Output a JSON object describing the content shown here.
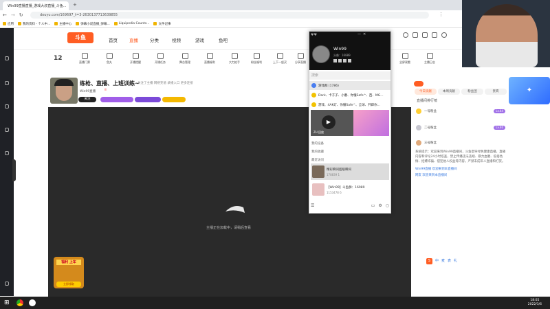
{
  "browser": {
    "tabs": [
      {
        "label": "Win99直播直播_游戏大叔直播_斗鱼..."
      },
      {
        "label": "Liquipedia Counts..."
      }
    ],
    "active_tab_label": "Win99直播直播_游戏大叔直播_斗鱼...",
    "url": "douyu.com/169697_t=3-2630137713639855",
    "bookmarks": [
      "应用",
      "我的资料 - 个人中...",
      "主播中心",
      "弹幕小说直播_弹幕...",
      "Liquipedia Counts...",
      "文件记事"
    ]
  },
  "site": {
    "logo": "斗鱼",
    "nav": [
      "首页",
      "直播",
      "分类",
      "视频",
      "游戏",
      "鱼吧"
    ],
    "icons": [
      "主播中心",
      "直播门票",
      "鱼丸",
      "开播提醒",
      "开播任务",
      "舞台管理",
      "直播福利",
      "大力拍手",
      "粉丝福利",
      "上下一起买",
      "分享直播",
      "全屏观看",
      "主播日志"
    ],
    "level": "12",
    "streamer": {
      "title": "练枪、直播、上班训练~",
      "name": "Win99直播",
      "badges": [
        "关注",
        "礼物",
        "直播"
      ],
      "subtitle": "关注了主播  网络充值  录播入口  更多连接",
      "hot": "8"
    }
  },
  "video": {
    "message": "主播正在加载中，请稍后查看",
    "promo": "福利 上车",
    "promo_button": "立即领取"
  },
  "rightpanel": {
    "tabs": [
      "今日贡献",
      "本周贡献",
      "粉丝团",
      "贵宾"
    ],
    "title": "直播间排行榜",
    "ranks": [
      {
        "name": "一号粉丝",
        "lv": "Lv.44"
      },
      {
        "name": "二号粉丝",
        "lv": "Lv.40"
      },
      {
        "name": "三号粉丝",
        "lv": ""
      }
    ],
    "chat": [
      {
        "text": "系统提示：欢迎来到Win99直播间，斗鱼倡导绿色健康直播，直播内容和评论24小时巡查，禁止传播违法违规、暴力血腥、低俗色情、招嫖诈骗、侵犯他人权益等内容。严禁未成年人直播和打赏。"
      },
      {
        "text": "Win99直播 欢迎来到本直播间"
      },
      {
        "text": "网友 欢迎来到本直播间"
      }
    ],
    "bottom_icons": [
      "S",
      "中",
      "麦",
      "表",
      "礼"
    ]
  },
  "qq": {
    "name": "Win99",
    "signature": "头像：16889",
    "search_placeholder": "搜索",
    "items": [
      {
        "label": "游戏群 (1786)"
      },
      {
        "label": "Dark、卡子子、小蘑、你懂Safe^、西、MG..."
      },
      {
        "label": "游戏、4AK灯、你懂Safe^、全球、开辟你..."
      }
    ],
    "sections": [
      "我的设备",
      "我的收藏",
      "最近访问"
    ],
    "recent": [
      {
        "title": "精彩瞬间超级瞬间",
        "sub": "178839  1"
      },
      {
        "title": "【Win99】斗鱼群：16989",
        "sub": "1153478  6"
      }
    ],
    "video_label": "ZH 回放"
  },
  "taskbar": {
    "time": "18:05",
    "date": "2022/3/6"
  }
}
